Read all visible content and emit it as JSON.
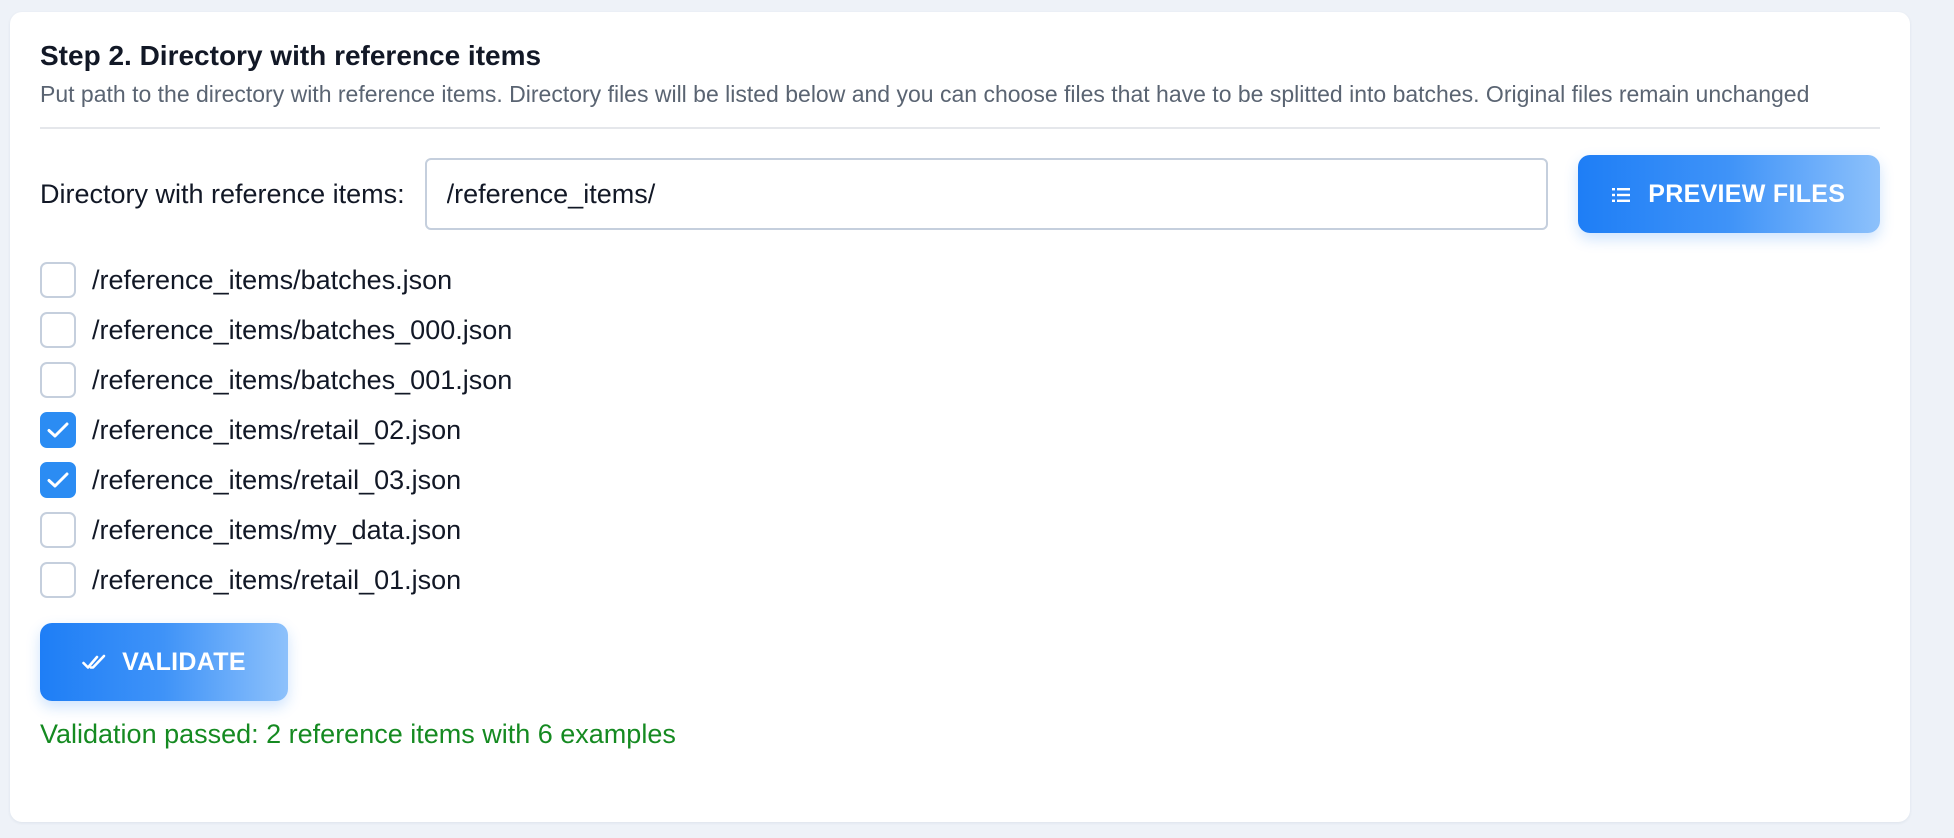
{
  "step": {
    "title": "Step 2. Directory with reference items",
    "description": "Put path to the directory with reference items. Directory files will be listed below and you can choose files that have to be splitted into batches. Original files remain unchanged"
  },
  "directory": {
    "label": "Directory with reference items:",
    "value": "/reference_items/"
  },
  "preview_button": {
    "label": "PREVIEW FILES",
    "icon": "list-icon"
  },
  "files": [
    {
      "path": "/reference_items/batches.json",
      "checked": false
    },
    {
      "path": "/reference_items/batches_000.json",
      "checked": false
    },
    {
      "path": "/reference_items/batches_001.json",
      "checked": false
    },
    {
      "path": "/reference_items/retail_02.json",
      "checked": true
    },
    {
      "path": "/reference_items/retail_03.json",
      "checked": true
    },
    {
      "path": "/reference_items/my_data.json",
      "checked": false
    },
    {
      "path": "/reference_items/retail_01.json",
      "checked": false
    }
  ],
  "validate_button": {
    "label": "VALIDATE",
    "icon": "double-check-icon"
  },
  "status": {
    "message": "Validation passed: 2 reference items with 6 examples",
    "color": "#158a21"
  },
  "colors": {
    "accent": "#1e7ef6",
    "checkbox_checked": "#2b8cf3"
  }
}
